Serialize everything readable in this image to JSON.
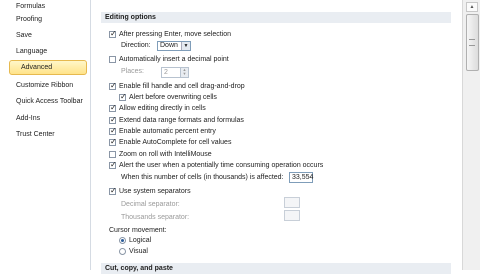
{
  "sidebar": {
    "items": [
      {
        "label": "Formulas"
      },
      {
        "label": "Proofing"
      },
      {
        "label": "Save"
      },
      {
        "label": "Language"
      },
      {
        "label": "Advanced",
        "selected": true
      },
      {
        "label": "Customize Ribbon"
      },
      {
        "label": "Quick Access Toolbar"
      },
      {
        "label": "Add-Ins"
      },
      {
        "label": "Trust Center"
      }
    ]
  },
  "editing": {
    "title": "Editing options",
    "after_enter": "After pressing Enter, move selection",
    "direction_label": "Direction:",
    "direction_value": "Down",
    "auto_decimal": "Automatically insert a decimal point",
    "places_label": "Places:",
    "places_value": "2",
    "fill_handle": "Enable fill handle and cell drag-and-drop",
    "alert_overwrite": "Alert before overwriting cells",
    "allow_edit": "Allow editing directly in cells",
    "extend_formats": "Extend data range formats and formulas",
    "percent_entry": "Enable automatic percent entry",
    "autocomplete": "Enable AutoComplete for cell values",
    "zoom_roll": "Zoom on roll with IntelliMouse",
    "alert_time": "Alert the user when a potentially time consuming operation occurs",
    "cells_affected": "When this number of cells (in thousands) is affected:",
    "cells_value": "33,554",
    "system_separators": "Use system separators",
    "decimal_sep": "Decimal separator:",
    "thousands_sep": "Thousands separator:",
    "cursor_movement": "Cursor movement:",
    "logical": "Logical",
    "visual": "Visual"
  },
  "cutcopy": {
    "title": "Cut, copy, and paste"
  },
  "icons": {
    "check": "✓",
    "dropdown": "▼",
    "spin_up": "▲",
    "spin_down": "▼",
    "scroll_up": "▲"
  }
}
